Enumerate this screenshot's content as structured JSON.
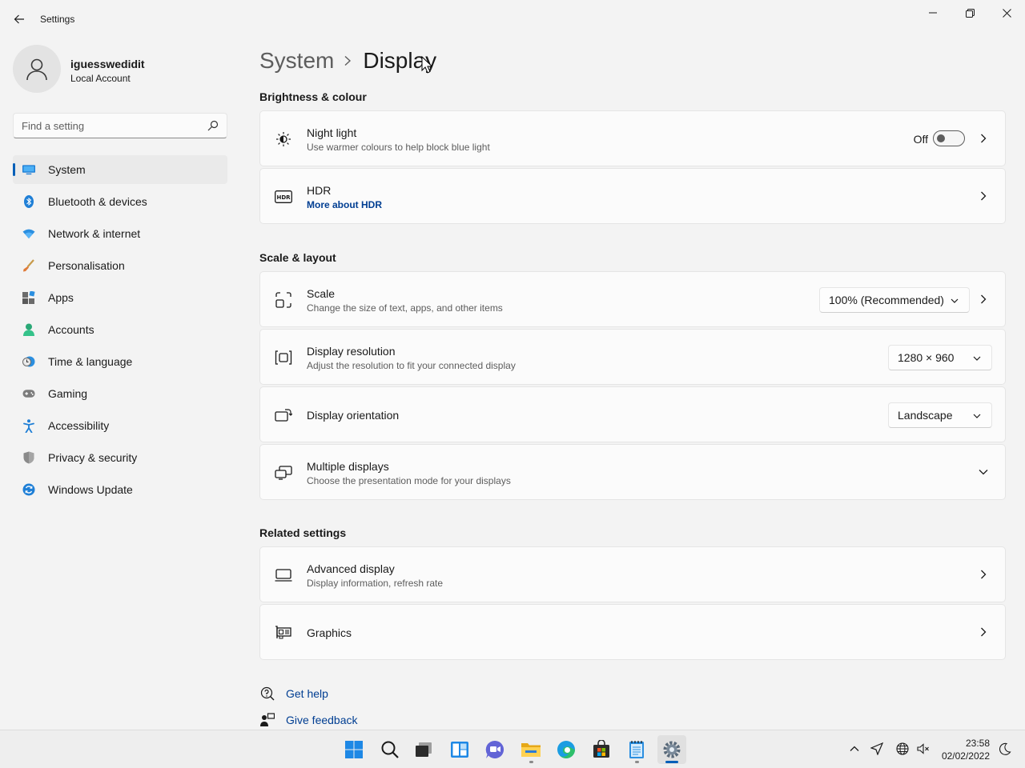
{
  "window": {
    "title": "Settings"
  },
  "user": {
    "name": "iguesswedidit",
    "account_type": "Local Account"
  },
  "search": {
    "placeholder": "Find a setting"
  },
  "nav": {
    "items": [
      {
        "label": "System",
        "icon": "monitor-icon",
        "active": true
      },
      {
        "label": "Bluetooth & devices",
        "icon": "bluetooth-icon"
      },
      {
        "label": "Network & internet",
        "icon": "wifi-icon"
      },
      {
        "label": "Personalisation",
        "icon": "brush-icon"
      },
      {
        "label": "Apps",
        "icon": "apps-icon"
      },
      {
        "label": "Accounts",
        "icon": "person-icon"
      },
      {
        "label": "Time & language",
        "icon": "clock-globe-icon"
      },
      {
        "label": "Gaming",
        "icon": "gamepad-icon"
      },
      {
        "label": "Accessibility",
        "icon": "accessibility-icon"
      },
      {
        "label": "Privacy & security",
        "icon": "shield-icon"
      },
      {
        "label": "Windows Update",
        "icon": "update-icon"
      }
    ]
  },
  "breadcrumb": {
    "parent": "System",
    "current": "Display"
  },
  "sections": {
    "brightness": "Brightness & colour",
    "scale_layout": "Scale & layout",
    "related": "Related settings"
  },
  "cards": {
    "night_light": {
      "title": "Night light",
      "subtitle": "Use warmer colours to help block blue light",
      "toggle_label": "Off",
      "toggle_on": false
    },
    "hdr": {
      "title": "HDR",
      "link": "More about HDR"
    },
    "scale": {
      "title": "Scale",
      "subtitle": "Change the size of text, apps, and other items",
      "value": "100% (Recommended)"
    },
    "resolution": {
      "title": "Display resolution",
      "subtitle": "Adjust the resolution to fit your connected display",
      "value": "1280 × 960"
    },
    "orientation": {
      "title": "Display orientation",
      "value": "Landscape"
    },
    "multiple": {
      "title": "Multiple displays",
      "subtitle": "Choose the presentation mode for your displays"
    },
    "advanced": {
      "title": "Advanced display",
      "subtitle": "Display information, refresh rate"
    },
    "graphics": {
      "title": "Graphics"
    }
  },
  "help": {
    "get_help": "Get help",
    "give_feedback": "Give feedback"
  },
  "taskbar": {
    "apps": [
      "start-icon",
      "search-icon",
      "task-view-icon",
      "widgets-icon",
      "chat-icon",
      "file-explorer-icon",
      "edge-icon",
      "store-icon",
      "notepad-icon",
      "settings-icon"
    ],
    "clock": {
      "time": "23:58",
      "date": "02/02/2022"
    }
  },
  "colors": {
    "accent": "#005fb8",
    "link": "#003e92",
    "background": "#f3f3f3",
    "card": "#fbfbfb"
  }
}
